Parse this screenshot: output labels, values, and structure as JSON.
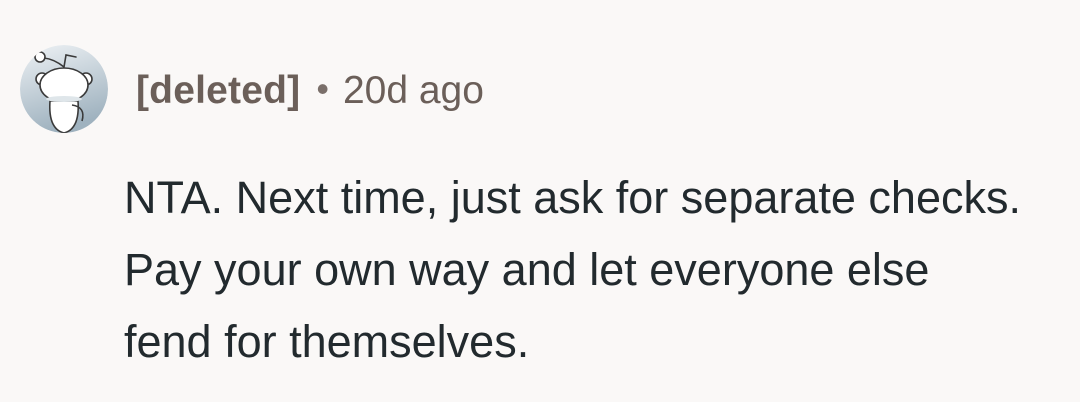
{
  "comment": {
    "author": "[deleted]",
    "separator": "•",
    "age": "20d ago",
    "body": "NTA. Next time, just ask for separate checks. Pay your own way and let everyone else fend for themselves.",
    "avatar_icon": "reddit-snoo-icon"
  },
  "colors": {
    "background": "#faf8f7",
    "meta_text": "#6b5f59",
    "body_text": "#222a2e",
    "avatar_bg": "#c9d4dc"
  }
}
